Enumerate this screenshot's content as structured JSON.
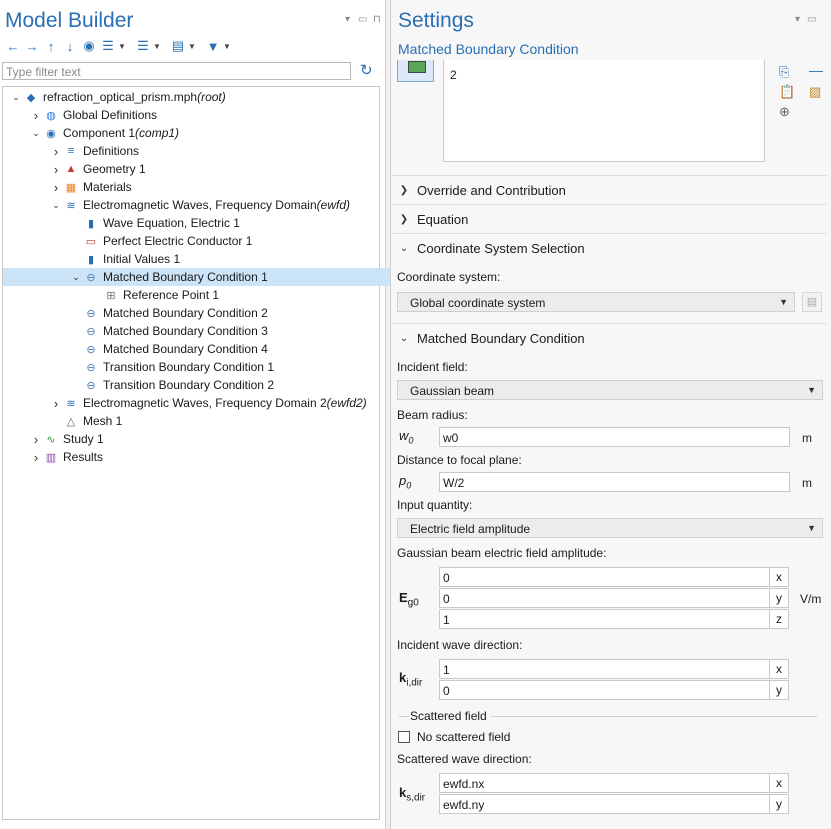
{
  "model_builder": {
    "title": "Model Builder",
    "filter_placeholder": "Type filter text",
    "tree": [
      {
        "label": "refraction_optical_prism.mph",
        "tag": "(root)",
        "icon": "model-icon",
        "expanded": true
      },
      {
        "label": "Global Definitions",
        "tag": "",
        "icon": "globe-icon",
        "expanded": false
      },
      {
        "label": "Component 1",
        "tag": "(comp1)",
        "icon": "component-icon",
        "expanded": true
      },
      {
        "label": "Definitions",
        "tag": "",
        "icon": "definitions-icon",
        "expanded": false
      },
      {
        "label": "Geometry 1",
        "tag": "",
        "icon": "geometry-icon",
        "expanded": false
      },
      {
        "label": "Materials",
        "tag": "",
        "icon": "materials-icon",
        "expanded": false
      },
      {
        "label": "Electromagnetic Waves, Frequency Domain",
        "tag": "(ewfd)",
        "icon": "physics-icon",
        "expanded": true
      },
      {
        "label": "Wave Equation, Electric 1",
        "tag": "",
        "icon": "domain-feature-icon"
      },
      {
        "label": "Perfect Electric Conductor 1",
        "tag": "",
        "icon": "boundary-feature-icon"
      },
      {
        "label": "Initial Values 1",
        "tag": "",
        "icon": "domain-feature-icon"
      },
      {
        "label": "Matched Boundary Condition 1",
        "tag": "",
        "icon": "boundary-condition-icon",
        "expanded": true,
        "selected": true
      },
      {
        "label": "Reference Point 1",
        "tag": "",
        "icon": "reference-point-icon"
      },
      {
        "label": "Matched Boundary Condition 2",
        "tag": "",
        "icon": "boundary-condition-icon"
      },
      {
        "label": "Matched Boundary Condition 3",
        "tag": "",
        "icon": "boundary-condition-icon"
      },
      {
        "label": "Matched Boundary Condition 4",
        "tag": "",
        "icon": "boundary-condition-icon"
      },
      {
        "label": "Transition Boundary Condition 1",
        "tag": "",
        "icon": "boundary-condition-icon"
      },
      {
        "label": "Transition Boundary Condition 2",
        "tag": "",
        "icon": "boundary-condition-icon"
      },
      {
        "label": "Electromagnetic Waves, Frequency Domain 2",
        "tag": "(ewfd2)",
        "icon": "physics-icon",
        "expanded": false
      },
      {
        "label": "Mesh 1",
        "tag": "",
        "icon": "mesh-icon"
      },
      {
        "label": "Study 1",
        "tag": "",
        "icon": "study-icon",
        "expanded": false
      },
      {
        "label": "Results",
        "tag": "",
        "icon": "results-icon",
        "expanded": false
      }
    ]
  },
  "settings": {
    "title": "Settings",
    "subtitle": "Matched Boundary Condition",
    "selection_list_value": "2",
    "sections": {
      "override": "Override and Contribution",
      "equation": "Equation",
      "coordinate": "Coordinate System Selection",
      "matched": "Matched Boundary Condition"
    },
    "coordinate_label": "Coordinate system:",
    "coordinate_value": "Global coordinate system",
    "incident_field_label": "Incident field:",
    "incident_field_value": "Gaussian beam",
    "beam_radius_label": "Beam radius:",
    "beam_radius_symbol": "w",
    "beam_radius_sub": "0",
    "beam_radius_value": "w0",
    "beam_radius_unit": "m",
    "focal_label": "Distance to focal plane:",
    "focal_symbol": "p",
    "focal_sub": "0",
    "focal_value": "W/2",
    "focal_unit": "m",
    "input_quantity_label": "Input quantity:",
    "input_quantity_value": "Electric field amplitude",
    "amplitude_label": "Gaussian beam electric field amplitude:",
    "amplitude_symbol": "E",
    "amplitude_sub": "g0",
    "amplitude": [
      {
        "v": "0",
        "c": "x"
      },
      {
        "v": "0",
        "c": "y"
      },
      {
        "v": "1",
        "c": "z"
      }
    ],
    "amplitude_unit": "V/m",
    "incident_dir_label": "Incident wave direction:",
    "incident_dir_symbol": "k",
    "incident_dir_sub": "i,dir",
    "incident_dir": [
      {
        "v": "1",
        "c": "x"
      },
      {
        "v": "0",
        "c": "y"
      }
    ],
    "scattered_group": "Scattered field",
    "no_scattered_label": "No scattered field",
    "no_scattered_checked": false,
    "scattered_dir_label": "Scattered wave direction:",
    "scattered_dir_symbol": "k",
    "scattered_dir_sub": "s,dir",
    "scattered_dir": [
      {
        "v": "ewfd.nx",
        "c": "x"
      },
      {
        "v": "ewfd.ny",
        "c": "y"
      }
    ]
  }
}
